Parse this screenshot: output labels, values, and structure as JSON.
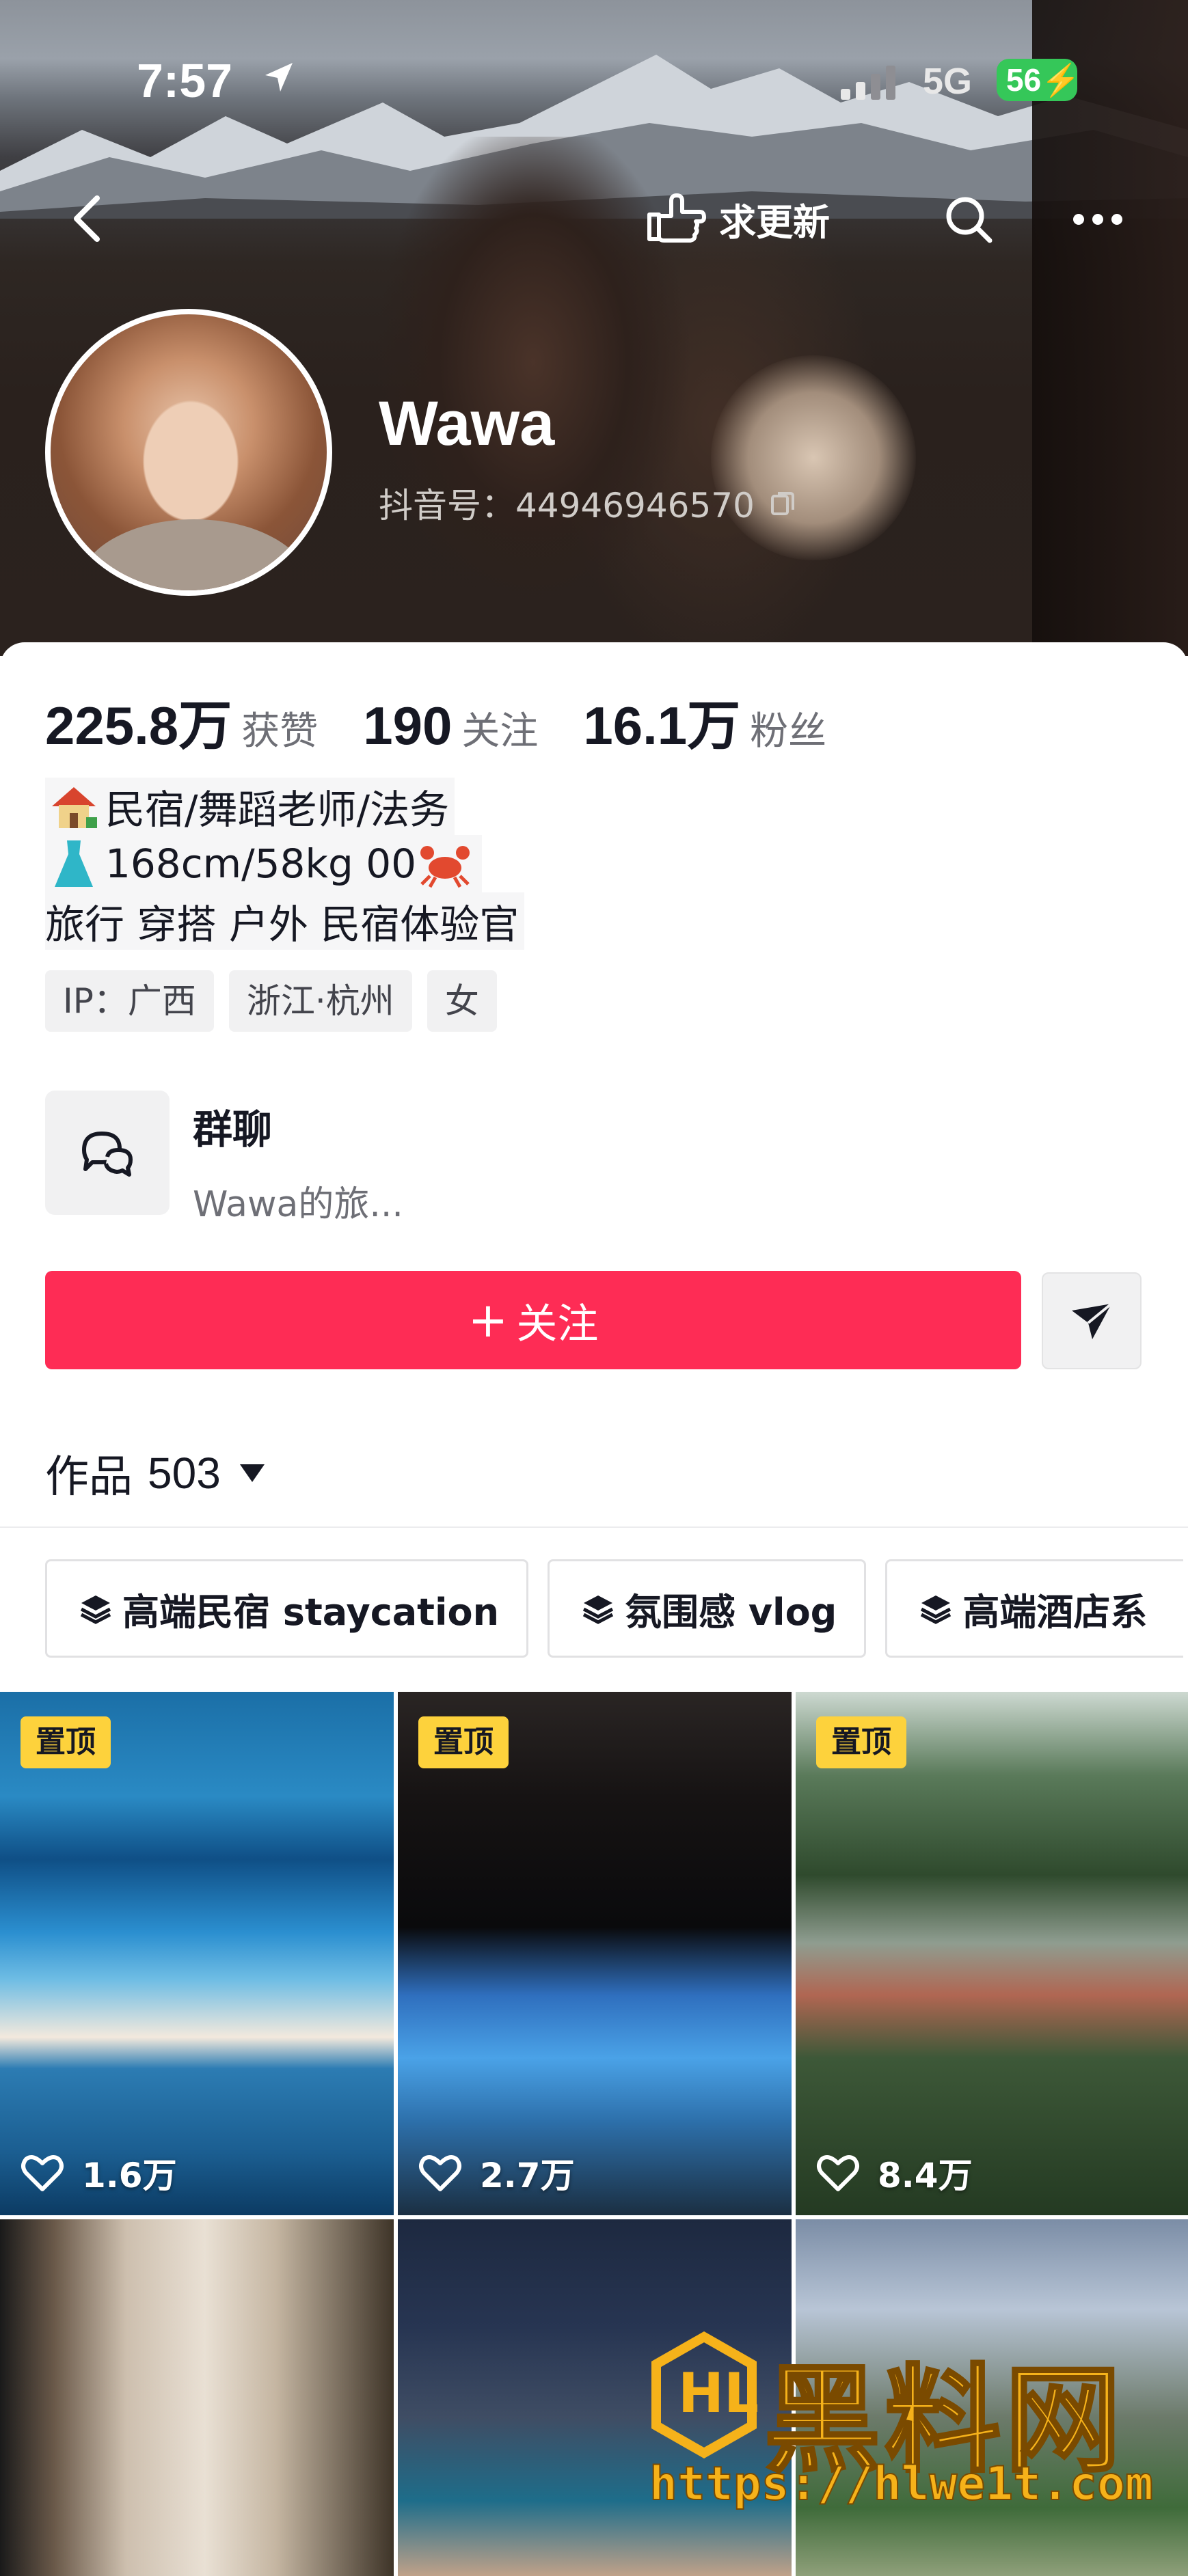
{
  "status_bar": {
    "time": "7:57",
    "network": "5G",
    "battery": "56"
  },
  "header": {
    "request_update_label": "求更新"
  },
  "profile": {
    "name": "Wawa",
    "douyin_id": "抖音号：44946946570"
  },
  "stats": [
    {
      "value": "225.8万",
      "label": "获赞"
    },
    {
      "value": "190",
      "label": "关注"
    },
    {
      "value": "16.1万",
      "label": "粉丝"
    }
  ],
  "bio": {
    "line1": "民宿/舞蹈老师/法务",
    "line2": "168cm/58kg  00",
    "line3": "旅行 穿搭 户外 民宿体验官"
  },
  "tags": [
    "IP：广西",
    "浙江·杭州",
    "女"
  ],
  "group_chat": {
    "title": "群聊",
    "subtitle": "Wawa的旅..."
  },
  "actions": {
    "follow_label": "关注"
  },
  "works": {
    "label": "作品",
    "count": "503"
  },
  "collections": [
    "高端民宿 staycation",
    "氛围感 vlog",
    "高端酒店系"
  ],
  "videos": [
    {
      "pinned_label": "置顶",
      "likes": "1.6万"
    },
    {
      "pinned_label": "置顶",
      "likes": "2.7万"
    },
    {
      "pinned_label": "置顶",
      "likes": "8.4万"
    }
  ],
  "watermark": {
    "title": "黑料网",
    "url": "https://hlwe1t.com"
  },
  "colors": {
    "accent": "#fe2c55",
    "pin_badge": "#fdd23c",
    "battery": "#35c759"
  }
}
